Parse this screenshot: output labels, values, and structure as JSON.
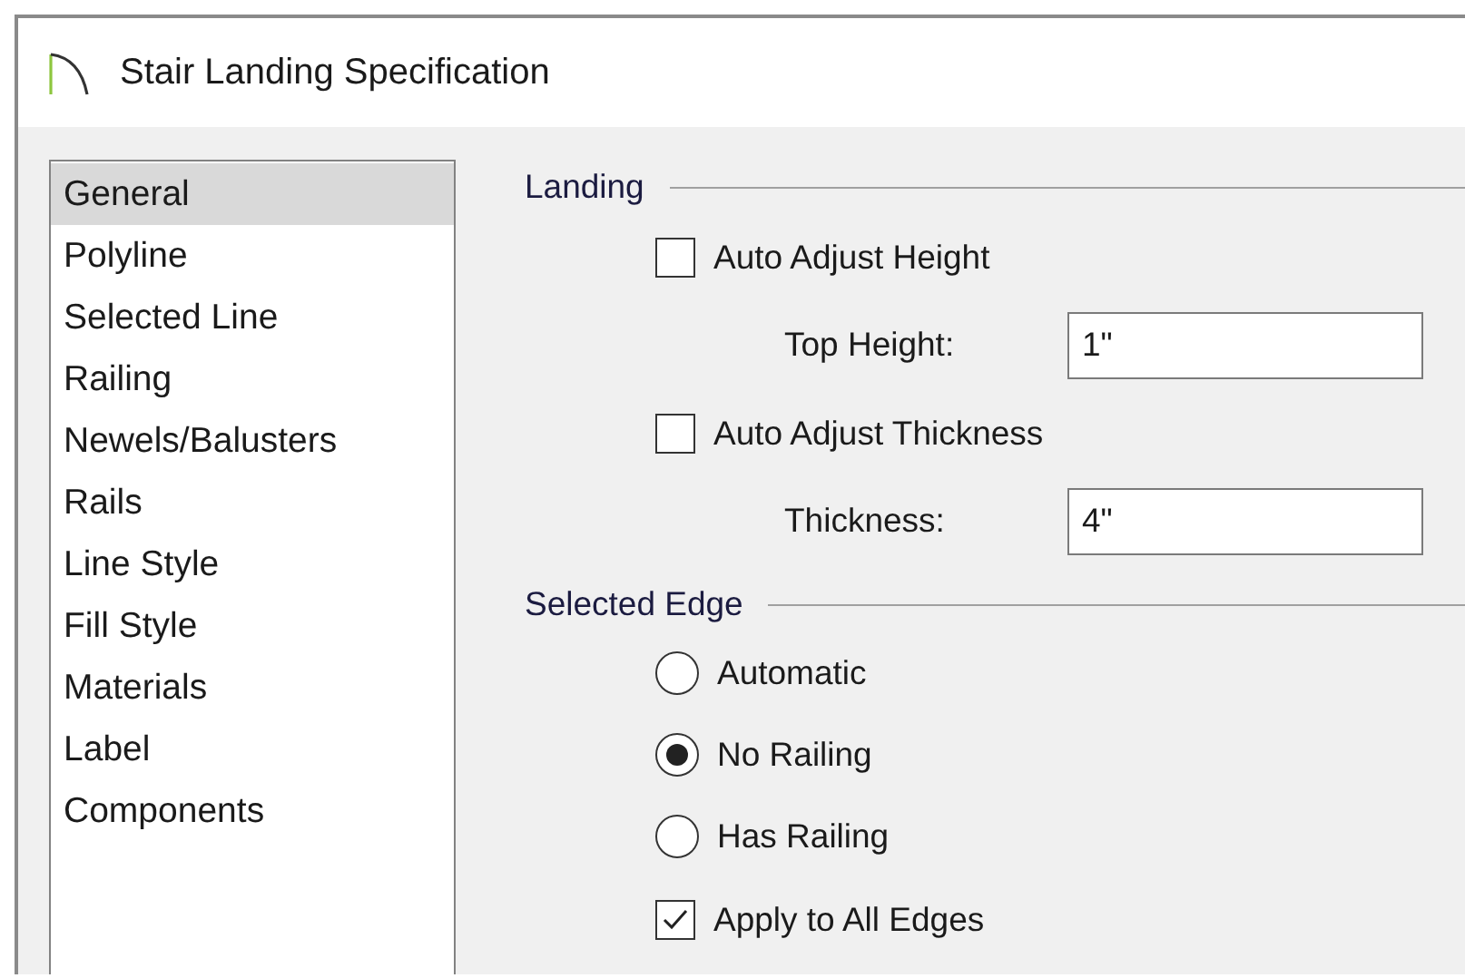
{
  "window": {
    "title": "Stair Landing Specification"
  },
  "sidebar": {
    "items": [
      {
        "label": "General",
        "selected": true
      },
      {
        "label": "Polyline",
        "selected": false
      },
      {
        "label": "Selected Line",
        "selected": false
      },
      {
        "label": "Railing",
        "selected": false
      },
      {
        "label": "Newels/Balusters",
        "selected": false
      },
      {
        "label": "Rails",
        "selected": false
      },
      {
        "label": "Line Style",
        "selected": false
      },
      {
        "label": "Fill Style",
        "selected": false
      },
      {
        "label": "Materials",
        "selected": false
      },
      {
        "label": "Label",
        "selected": false
      },
      {
        "label": "Components",
        "selected": false
      }
    ]
  },
  "sections": [
    {
      "title": "Landing",
      "items": [
        {
          "kind": "checkbox",
          "label": "Auto Adjust Height",
          "checked": false
        },
        {
          "kind": "field",
          "label": "Top Height:",
          "value": "1\""
        },
        {
          "kind": "checkbox",
          "label": "Auto Adjust Thickness",
          "checked": false
        },
        {
          "kind": "field",
          "label": "Thickness:",
          "value": "4\""
        }
      ]
    },
    {
      "title": "Selected Edge",
      "items": [
        {
          "kind": "radio",
          "label": "Automatic",
          "selected": false
        },
        {
          "kind": "radio",
          "label": "No Railing",
          "selected": true
        },
        {
          "kind": "radio",
          "label": "Has Railing",
          "selected": false
        },
        {
          "kind": "checkbox",
          "label": "Apply to All Edges",
          "checked": true
        }
      ]
    }
  ]
}
